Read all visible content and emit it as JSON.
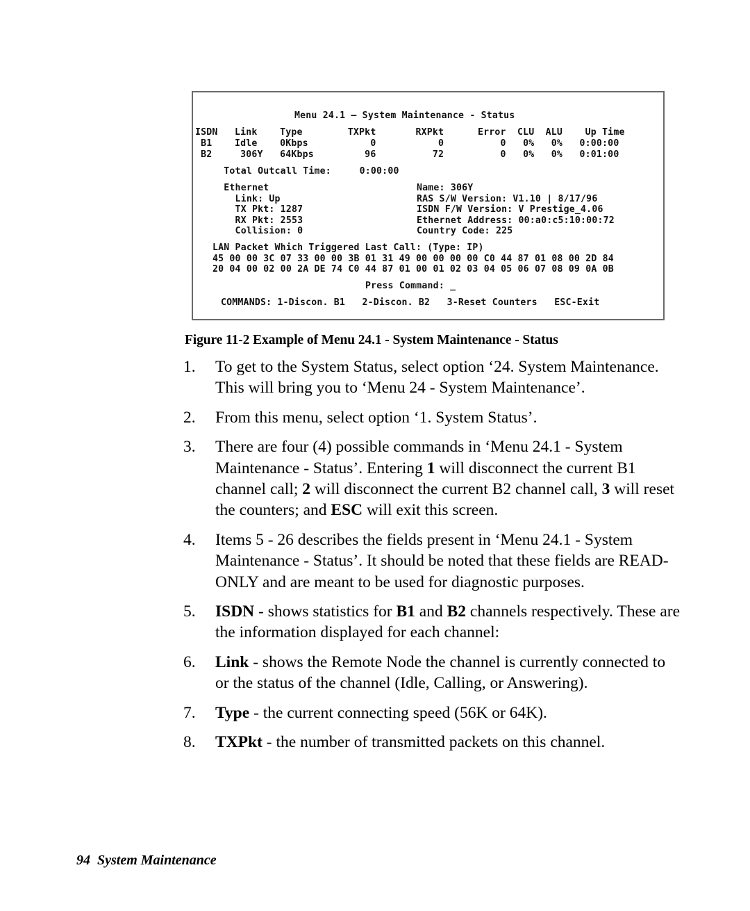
{
  "figure": {
    "caption": "Figure 11-2 Example of Menu 24.1 - System Maintenance - Status",
    "terminal": {
      "title": "Menu 24.1 — System Maintenance - Status",
      "table": {
        "headers": [
          "ISDN",
          "Link",
          "Type",
          "TXPkt",
          "RXPkt",
          "Error",
          "CLU",
          "ALU",
          "Up Time"
        ],
        "header_line": "ISDN   Link    Type        TXPkt       RXPkt      Error  CLU  ALU    Up Time",
        "rows": [
          {
            "isdn": "B1",
            "link": "Idle",
            "type": "0Kbps",
            "txpkt": "0",
            "rxpkt": "0",
            "error": "0",
            "clu": "0%",
            "alu": "0%",
            "uptime": "0:00:00",
            "line": " B1    Idle    0Kbps           0           0          0   0%   0%   0:00:00"
          },
          {
            "isdn": "B2",
            "link": "306Y",
            "type": "64Kbps",
            "txpkt": "96",
            "rxpkt": "72",
            "error": "0",
            "clu": "0%",
            "alu": "0%",
            "uptime": "0:01:00",
            "line": " B2     306Y   64Kbps         96          72          0   0%   0%   0:01:00"
          }
        ]
      },
      "total_outcall_label": "Total Outcall Time:",
      "total_outcall_value": "0:00:00",
      "total_outcall_line": "  Total Outcall Time:     0:00:00",
      "ethernet": {
        "heading": "Ethernet",
        "link_label": "Link:",
        "link_value": "Up",
        "tx_pkt_label": "TX Pkt:",
        "tx_pkt_value": "1287",
        "rx_pkt_label": "RX Pkt:",
        "rx_pkt_value": "2553",
        "collision_label": "Collision:",
        "collision_value": "0",
        "lines": [
          "  Ethernet",
          "    Link: Up",
          "    TX Pkt: 1287",
          "    RX Pkt: 2553",
          "    Collision: 0"
        ]
      },
      "system_info": {
        "name_label": "Name:",
        "name_value": "306Y",
        "ras_sw_label": "RAS S/W Version:",
        "ras_sw_value": "V1.10 | 8/17/96",
        "isdn_fw_label": "ISDN F/W Version:",
        "isdn_fw_value": "V Prestige_4.06",
        "ethernet_address_label": "Ethernet Address:",
        "ethernet_address_value": "00:a0:c5:10:00:72",
        "country_code_label": "Country Code:",
        "country_code_value": "225",
        "lines": [
          "Name: 306Y",
          "RAS S/W Version: V1.10 | 8/17/96",
          "ISDN F/W Version: V Prestige_4.06",
          "Ethernet Address: 00:a0:c5:10:00:72",
          "Country Code: 225"
        ]
      },
      "lan_packet": {
        "heading": "LAN Packet Which Triggered Last Call: (Type: IP)",
        "hex_line_1": "45 00 00 3C 07 33 00 00 3B 01 31 49 00 00 00 00 C0 44 87 01 08 00 2D 84",
        "hex_line_2": "20 04 00 02 00 2A DE 74 C0 44 87 01 00 01 02 03 04 05 06 07 08 09 0A 0B"
      },
      "press_command": "Press Command: _",
      "commands_line": "COMMANDS: 1-Discon. B1   2-Discon. B2   3-Reset Counters   ESC-Exit",
      "commands": {
        "label": "COMMANDS:",
        "items": [
          "1-Discon. B1",
          "2-Discon. B2",
          "3-Reset Counters",
          "ESC-Exit"
        ]
      }
    }
  },
  "steps": [
    {
      "num": "1.",
      "html": "To get to the System Status, select option ‘24. System Maintenance. This will bring you to ‘Menu 24 - System Maintenance’."
    },
    {
      "num": "2.",
      "html": "From this menu, select option ‘1. System Status’."
    },
    {
      "num": "3.",
      "html": "There are four (4) possible commands in ‘Menu 24.1 - System Maintenance - Status’. Entering <b>1</b> will disconnect the current B1 channel call; <b>2</b> will disconnect the current B2 channel call, <b>3</b> will reset the counters; and <b>ESC</b> will exit this screen."
    },
    {
      "num": "4.",
      "html": "Items 5 - 26 describes the fields present in ‘Menu 24.1 - System Maintenance - Status’. It should be noted that these fields are READ-ONLY and are meant to be used for diagnostic purposes."
    },
    {
      "num": "5.",
      "html": "<b>ISDN</b> - shows statistics for <b>B1</b> and <b>B2</b> channels respectively. These are the information displayed for each channel:"
    },
    {
      "num": "6.",
      "html": "<b>Link</b> - shows the Remote Node the channel is currently connected to or the status of the channel (Idle, Calling, or Answering)."
    },
    {
      "num": "7.",
      "html": "<b>Type</b> - the current connecting speed (56K or 64K)."
    },
    {
      "num": "8.",
      "html": "<b>TXPkt</b> - the number of transmitted packets on this channel."
    }
  ],
  "footer": {
    "page_number": "94",
    "section": "System Maintenance",
    "text": "94  System Maintenance"
  }
}
